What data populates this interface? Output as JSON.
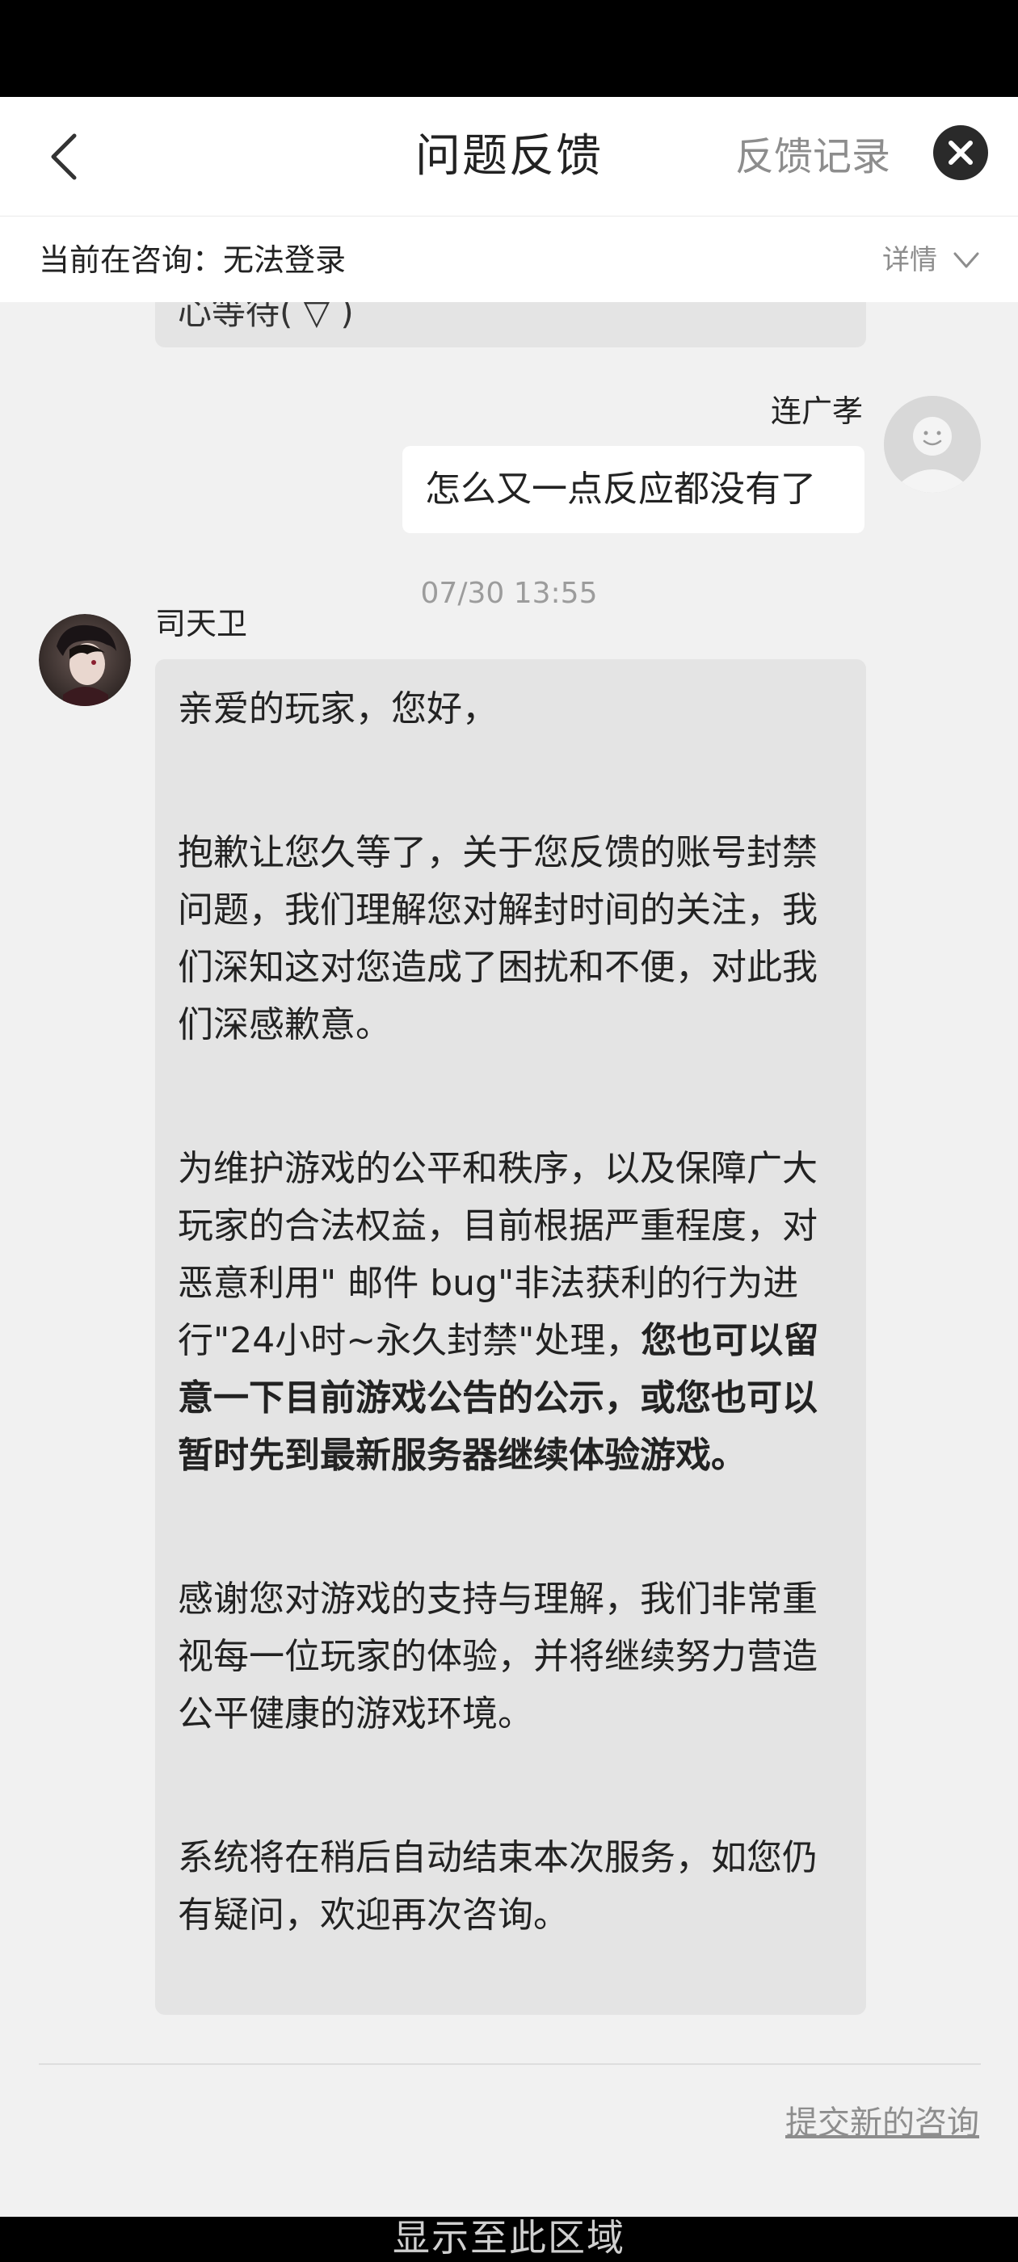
{
  "header": {
    "title": "问题反馈",
    "history_label": "反馈记录"
  },
  "consult": {
    "label": "当前在咨询：无法登录",
    "detail_label": "详情"
  },
  "chat": {
    "previous_fragment": "心等待(      ▽      )",
    "user_message": {
      "name": "连广孝",
      "text": "怎么又一点反应都没有了"
    },
    "timestamp": "07/30 13:55",
    "agent_message": {
      "name": "司天卫",
      "greeting": "亲爱的玩家，您好，",
      "p1": "抱歉让您久等了，关于您反馈的账号封禁问题，我们理解您对解封时间的关注，我们深知这对您造成了困扰和不便，对此我们深感歉意。",
      "p2_normal": "为维护游戏的公平和秩序，以及保障广大玩家的合法权益，目前根据严重程度，对恶意利用\" 邮件 bug\"非法获利的行为进行\"24小时~永久封禁\"处理，",
      "p2_bold": "您也可以留意一下目前游戏公告的公示，或您也可以暂时先到最新服务器继续体验游戏。",
      "p3": "感谢您对游戏的支持与理解，我们非常重视每一位玩家的体验，并将继续努力营造公平健康的游戏环境。",
      "p4": "系统将在稍后自动结束本次服务，如您仍有疑问，欢迎再次咨询。"
    }
  },
  "footer": {
    "new_consult_label": "提交新的咨询",
    "overlay_text": "显示至此区域"
  },
  "icons": {
    "back": "chevron-left-icon",
    "close": "close-icon",
    "detail": "chevron-down-icon"
  },
  "colors": {
    "background": "#f1f1f1",
    "bubble_agent": "#e4e4e4",
    "bubble_user": "#ffffff",
    "muted_text": "#8d8d8d"
  }
}
